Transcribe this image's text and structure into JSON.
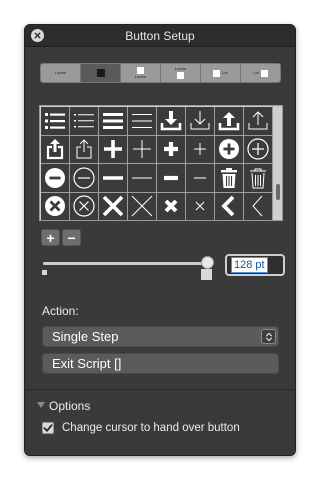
{
  "window": {
    "title": "Button Setup"
  },
  "style_segments": [
    {
      "label": "Lorem",
      "selected": false
    },
    {
      "label": "",
      "selected": true
    },
    {
      "label": "Lorem",
      "selected": false
    },
    {
      "label": "Lorem",
      "selected": false
    },
    {
      "label": "Lor",
      "selected": false
    },
    {
      "label": "Lor",
      "selected": false
    }
  ],
  "icon_rows": [
    [
      "list-bullets-filled-icon",
      "list-bullets-outline-icon",
      "lines-filled-icon",
      "lines-outline-icon",
      "download-filled-icon",
      "download-outline-icon",
      "upload-filled-icon",
      "upload-outline-icon"
    ],
    [
      "share-filled-icon",
      "share-outline-icon",
      "plus-bold-icon",
      "plus-thin-icon",
      "plus-filled-icon",
      "plus-light-icon",
      "plus-circle-filled-icon",
      "plus-circle-outline-icon"
    ],
    [
      "minus-circle-filled-icon",
      "minus-circle-outline-icon",
      "minus-bold-icon",
      "minus-thin-icon",
      "minus-filled-icon",
      "minus-light-icon",
      "trash-filled-icon",
      "trash-outline-icon"
    ],
    [
      "close-circle-filled-icon",
      "close-circle-outline-icon",
      "x-bold-icon",
      "x-thin-icon",
      "x-filled-icon",
      "x-light-icon",
      "chevron-left-bold-icon",
      "chevron-left-thin-icon"
    ]
  ],
  "controls": {
    "add_label": "+",
    "remove_label": "−"
  },
  "size": {
    "value": "128 pt",
    "level": 0.95
  },
  "action": {
    "label": "Action:",
    "selected": "Single Step",
    "script_label": "Exit Script []"
  },
  "options": {
    "label": "Options",
    "checkbox_label": "Change cursor to hand over button",
    "checked": true
  },
  "colors": {
    "window_bg": "#3a3a3a",
    "popup_bg": "#5b5b5b",
    "accent": "#4a90e2"
  }
}
